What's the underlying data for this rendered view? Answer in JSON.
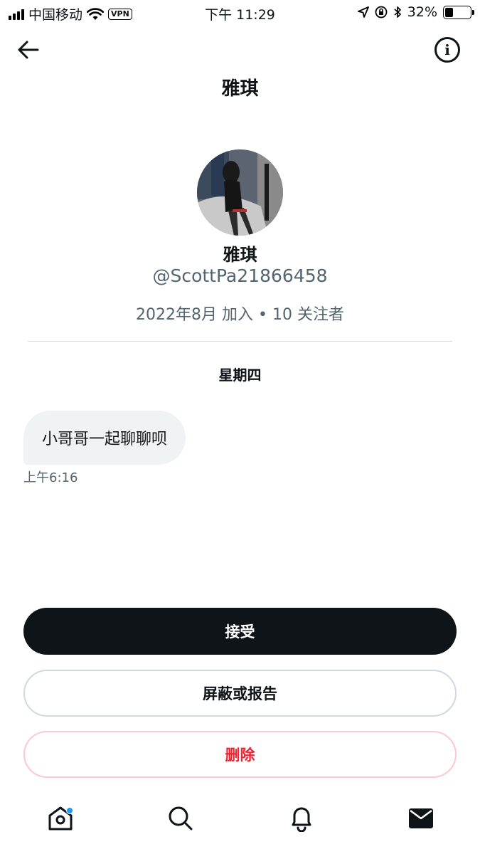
{
  "status_bar": {
    "carrier": "中国移动",
    "vpn": "VPN",
    "time": "下午 11:29",
    "battery": "32%",
    "battery_level": 0.32
  },
  "header": {
    "title": "雅琪",
    "back_icon": "arrow-left-icon",
    "info_icon": "info-icon"
  },
  "profile": {
    "name": "雅琪",
    "handle": "@ScottPa21866458",
    "meta": "2022年8月 加入 • 10 关注者"
  },
  "conversation": {
    "day_label": "星期四",
    "messages": [
      {
        "text": "小哥哥一起聊聊呗",
        "time": "上午6:16"
      }
    ]
  },
  "actions": {
    "accept": "接受",
    "block_or_report": "屏蔽或报告",
    "delete": "删除"
  },
  "tabbar": {
    "items": [
      "home-icon",
      "search-icon",
      "bell-icon",
      "mail-icon"
    ]
  },
  "colors": {
    "primary_text": "#0f1419",
    "secondary_text": "#536471",
    "danger": "#f4212e",
    "accent": "#1d9bf0"
  }
}
